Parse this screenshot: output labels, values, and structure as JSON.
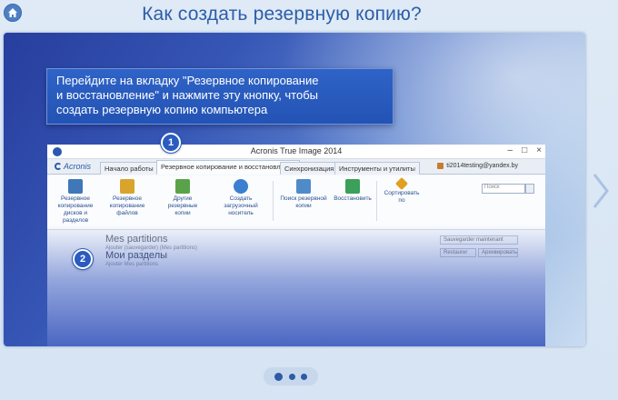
{
  "page": {
    "title": "Как создать резервную копию?"
  },
  "callout": {
    "lines": [
      "Перейдите на вкладку \"Резервное копирование",
      "и восстановление\" и нажмите эту кнопку, чтобы",
      "создать резервную копию компьютера"
    ]
  },
  "app": {
    "title": "Acronis True Image 2014",
    "controls": [
      "–",
      "□",
      "×"
    ],
    "logo": "Acronis",
    "tabs": [
      {
        "label": "Начало работы",
        "active": false
      },
      {
        "label": "Резервное копирование и восстановление",
        "active": true
      },
      {
        "label": "Синхронизация",
        "active": false
      },
      {
        "label": "Инструменты и утилиты",
        "active": false
      }
    ],
    "account": "ti2014testing@yandex.by",
    "search_placeholder": "Поиск",
    "ribbon": [
      {
        "label": "Резервное копирование дисков и разделов",
        "icon": "disk-backup-icon",
        "color": "#3f77b8"
      },
      {
        "label": "Резервное копирование файлов",
        "icon": "file-backup-icon",
        "color": "#d9a42b"
      },
      {
        "label": "Другие резервные копии",
        "icon": "other-backup-icon",
        "color": "#5aa24a"
      },
      {
        "label": "Создать загрузочный носитель",
        "icon": "boot-media-icon",
        "color": "#3a7fd0"
      },
      {
        "label": "Поиск резервной копии",
        "icon": "search-backup-icon",
        "color": "#4f8bc9"
      },
      {
        "label": "Восстановить",
        "icon": "restore-icon",
        "color": "#3aa05a"
      },
      {
        "label": "Сортировать по",
        "icon": "sort-icon",
        "color": "#e0a020"
      }
    ],
    "list": {
      "item1_title": "Mes partitions",
      "item1_sub": "Ajouter (sauvegarder) (Mes partitions)",
      "item2_title": "Мои разделы",
      "item2_sub": "Ajouter Mes partitions",
      "btn1": "Sauvegarder maintenant",
      "btn2": "Restaurer",
      "btn3": "Архивировать"
    }
  },
  "badges": {
    "step1": "1",
    "step2": "2"
  },
  "colors": {
    "accent": "#2d5ea8",
    "callout_bg": "#2353b4",
    "badge": "#2a5bc0"
  }
}
